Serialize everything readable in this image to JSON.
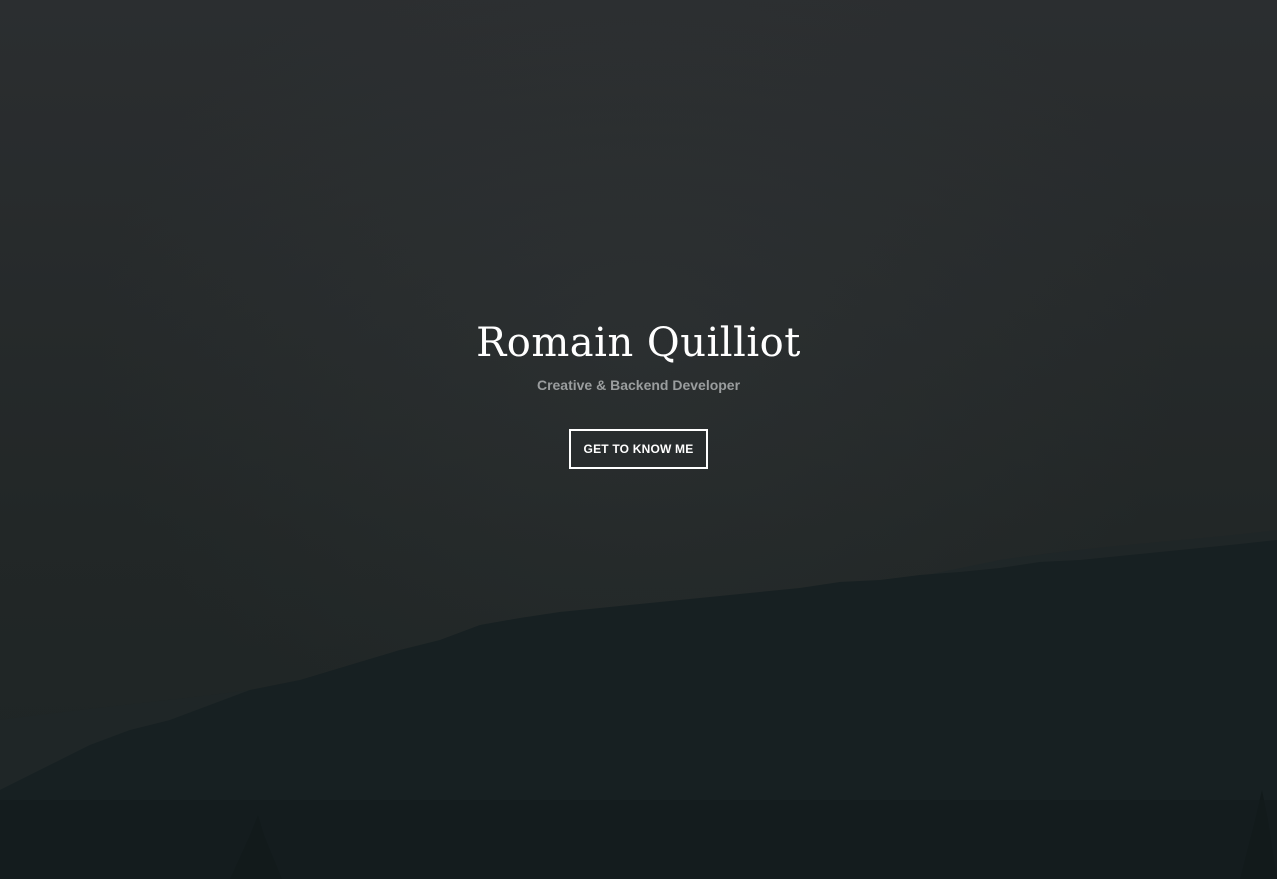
{
  "hero": {
    "title": "Romain Quilliot",
    "subtitle": "Creative & Backend Developer",
    "cta_label": "GET TO KNOW ME",
    "background": "misty forested hillside at dusk, dark overlay"
  },
  "colors": {
    "overlay": "#262a2b",
    "forest": "#172022",
    "title": "#ffffff",
    "subtitle": "#9a9d9e",
    "button_border": "#ffffff"
  }
}
